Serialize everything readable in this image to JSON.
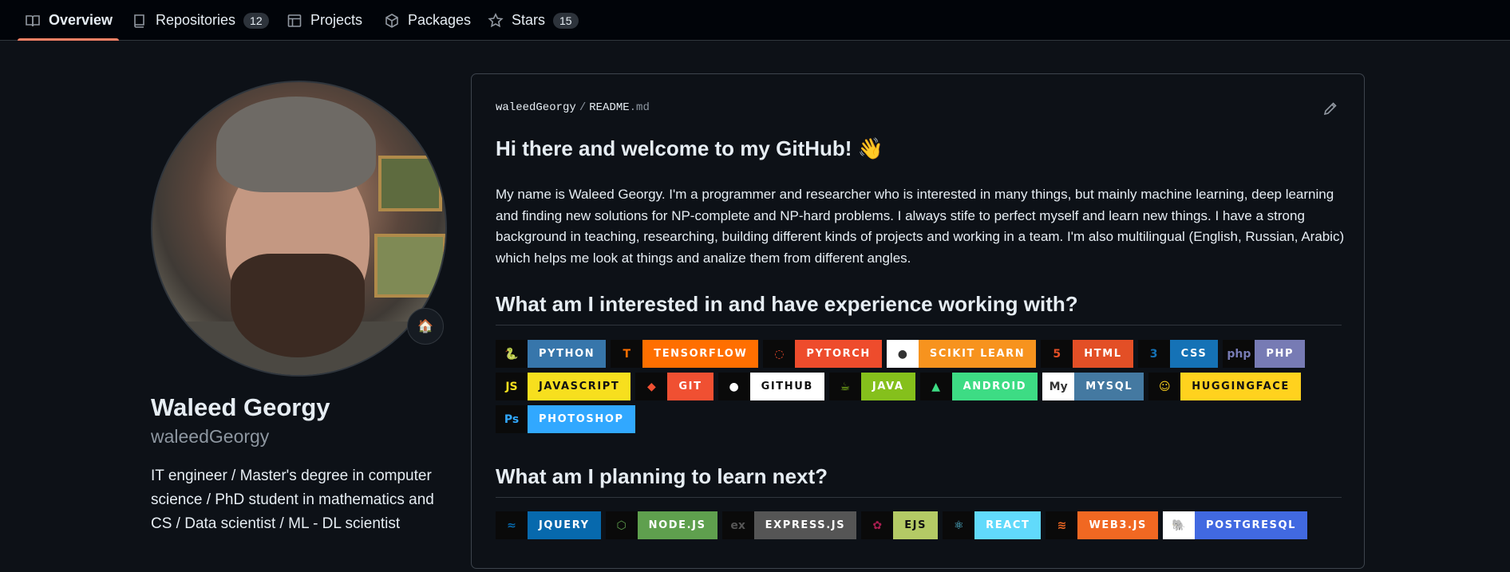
{
  "tabs": [
    {
      "label": "Overview",
      "icon": "book-icon",
      "count": null
    },
    {
      "label": "Repositories",
      "icon": "repo-icon",
      "count": "12"
    },
    {
      "label": "Projects",
      "icon": "table-icon",
      "count": null
    },
    {
      "label": "Packages",
      "icon": "package-icon",
      "count": null
    },
    {
      "label": "Stars",
      "icon": "star-icon",
      "count": "15"
    }
  ],
  "profile": {
    "name": "Waleed Georgy",
    "login": "waleedGeorgy",
    "bio": "IT engineer / Master's degree in computer science / PhD student in mathematics and CS / Data scientist / ML - DL scientist",
    "status_emoji": "🏠"
  },
  "readme": {
    "owner": "waleedGeorgy",
    "file_base": "README",
    "file_ext": ".md",
    "heading": "Hi there and welcome to my GitHub! 👋",
    "intro": "My name is Waleed Georgy. I'm a programmer and researcher who is interested in many things, but mainly machine learning, deep learning and finding new solutions for NP-complete and NP-hard problems. I always stife to perfect myself and learn new things. I have a strong background in teaching, researching, building different kinds of projects and working in a team. I'm also multilingual (English, Russian, Arabic) which helps me look at things and analize them from different angles.",
    "interests_heading": "What am I interested in and have experience working with?",
    "learn_heading": "What am I planning to learn next?"
  },
  "skills": [
    {
      "label": "PYTHON",
      "color": "#3776ab",
      "logo": "🐍",
      "logo_bg": "#0a0a0a"
    },
    {
      "label": "TENSORFLOW",
      "color": "#ff6f00",
      "logo": "T",
      "logo_bg": "#0a0a0a"
    },
    {
      "label": "PYTORCH",
      "color": "#ee4c2c",
      "logo": "◌",
      "logo_bg": "#0a0a0a"
    },
    {
      "label": "SCIKIT LEARN",
      "color": "#f7931e",
      "logo": "●",
      "logo_bg": "#ffffff"
    },
    {
      "label": "HTML",
      "color": "#e34f26",
      "logo": "5",
      "logo_bg": "#0a0a0a"
    },
    {
      "label": "CSS",
      "color": "#1572b6",
      "logo": "3",
      "logo_bg": "#0a0a0a"
    },
    {
      "label": "PHP",
      "color": "#777bb4",
      "logo": "php",
      "logo_bg": "#0a0a0a"
    },
    {
      "label": "JAVASCRIPT",
      "color": "#f7df1e",
      "logo": "JS",
      "logo_bg": "#0a0a0a"
    },
    {
      "label": "GIT",
      "color": "#f05032",
      "logo": "◆",
      "logo_bg": "#0a0a0a"
    },
    {
      "label": "GITHUB",
      "color": "#ffffff",
      "logo": "●",
      "logo_bg": "#0a0a0a"
    },
    {
      "label": "JAVA",
      "color": "#85c01c",
      "logo": "☕",
      "logo_bg": "#0a0a0a"
    },
    {
      "label": "ANDROID",
      "color": "#3ddc84",
      "logo": "▲",
      "logo_bg": "#0a0a0a"
    },
    {
      "label": "MYSQL",
      "color": "#4479a1",
      "logo": "My",
      "logo_bg": "#ffffff"
    },
    {
      "label": "HUGGINGFACE",
      "color": "#ffd21e",
      "logo": "☺",
      "logo_bg": "#0a0a0a"
    },
    {
      "label": "PHOTOSHOP",
      "color": "#31a8ff",
      "logo": "Ps",
      "logo_bg": "#0a0a0a"
    }
  ],
  "learn_next": [
    {
      "label": "JQUERY",
      "color": "#0769ad",
      "logo": "≈",
      "logo_bg": "#0a0a0a"
    },
    {
      "label": "NODE.JS",
      "color": "#5fa04e",
      "logo": "⬡",
      "logo_bg": "#0a0a0a"
    },
    {
      "label": "EXPRESS.JS",
      "color": "#555555",
      "logo": "ex",
      "logo_bg": "#0a0a0a"
    },
    {
      "label": "EJS",
      "color": "#a91e50",
      "logo": "✿",
      "logo_bg": "#0a0a0a"
    },
    {
      "label": "REACT",
      "color": "#61dafb",
      "logo": "⚛",
      "logo_bg": "#0a0a0a"
    },
    {
      "label": "WEB3.JS",
      "color": "#f16822",
      "logo": "≋",
      "logo_bg": "#0a0a0a"
    },
    {
      "label": "POSTGRESQL",
      "color": "#4169e1",
      "logo": "🐘",
      "logo_bg": "#ffffff"
    }
  ]
}
